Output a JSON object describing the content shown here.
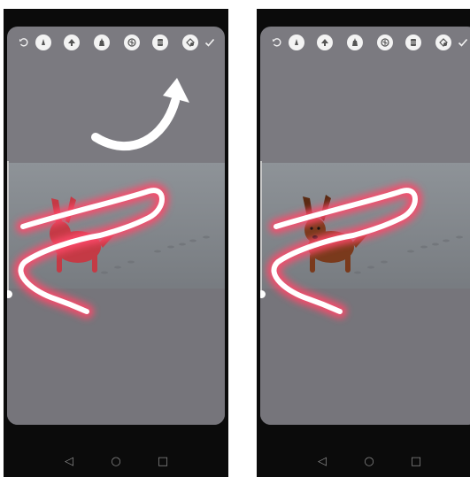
{
  "panels": [
    {
      "id": "before",
      "toolbar": [
        "undo-icon",
        "marker-pen-icon",
        "arrow-pen-icon",
        "highlighter-icon",
        "neon-brush-icon",
        "eraser-icon",
        "color-fill-icon",
        "checkmark-icon"
      ],
      "has_arrow": true,
      "dog_color": "#c43a45"
    },
    {
      "id": "after",
      "toolbar": [
        "undo-icon",
        "marker-pen-icon",
        "arrow-pen-icon",
        "highlighter-icon",
        "neon-brush-icon",
        "eraser-icon",
        "color-fill-icon",
        "checkmark-icon"
      ],
      "has_arrow": false,
      "dog_color": "#7a3a1c"
    }
  ],
  "brush": {
    "stroke_color": "#ffffff",
    "glow_color": "#ff4a6a"
  },
  "navigation": {
    "back_glyph": "◁",
    "home_glyph": "○",
    "recents_glyph": "□"
  }
}
